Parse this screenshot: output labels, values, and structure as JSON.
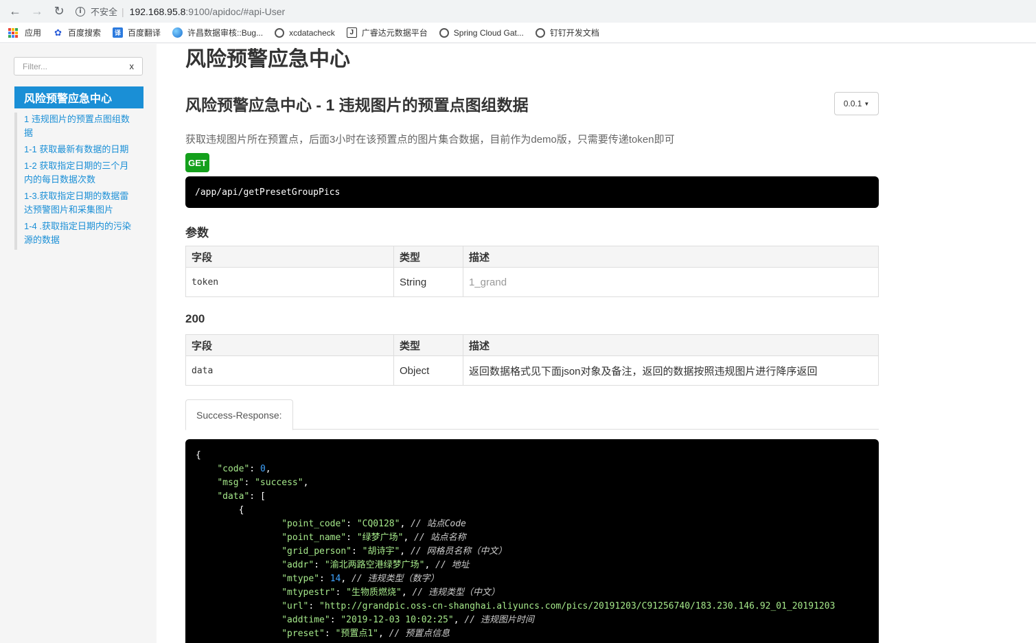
{
  "browser": {
    "insecure_label": "不安全",
    "url_host": "192.168.95.8",
    "url_path": ":9100/apidoc/#api-User",
    "bookmarks": [
      "应用",
      "百度搜索",
      "百度翻译",
      "许昌数据审核::Bug...",
      "xcdatacheck",
      "广睿达元数据平台",
      "Spring Cloud Gat...",
      "钉钉开发文档"
    ]
  },
  "sidebar": {
    "filter_placeholder": "Filter...",
    "filter_clear": "x",
    "header": "风险预警应急中心",
    "items": [
      "1 违规图片的预置点图组数据",
      "1-1 获取最新有数据的日期",
      "1-2 获取指定日期的三个月内的每日数据次数",
      "1-3.获取指定日期的数据雷达预警图片和采集图片",
      "1-4 .获取指定日期内的污染源的数据"
    ]
  },
  "main": {
    "group_title": "风险预警应急中心",
    "api_title": "风险预警应急中心 - 1 违规图片的预置点图组数据",
    "version": "0.0.1",
    "description": "获取违规图片所在预置点，后面3小时在该预置点的图片集合数据，目前作为demo版，只需要传递token即可",
    "method": "GET",
    "endpoint": "/app/api/getPresetGroupPics",
    "params_title": "参数",
    "params_headers": [
      "字段",
      "类型",
      "描述"
    ],
    "params_rows": [
      [
        "token",
        "String",
        "1_grand"
      ]
    ],
    "success_title": "200",
    "success_headers": [
      "字段",
      "类型",
      "描述"
    ],
    "success_rows": [
      [
        "data",
        "Object",
        "返回数据格式见下面json对象及备注，返回的数据按照违规图片进行降序返回"
      ]
    ],
    "response_tab": "Success-Response:",
    "code": {
      "l1": "{",
      "code_key": "\"code\"",
      "code_val": "0",
      "msg_key": "\"msg\"",
      "msg_val": "\"success\"",
      "data_key": "\"data\"",
      "data_open": "[",
      "obj_open": "{",
      "point_code_key": "\"point_code\"",
      "point_code_val": "\"CQ0128\"",
      "point_code_cmt": "// 站点Code",
      "point_name_key": "\"point_name\"",
      "point_name_val": "\"绿梦广场\"",
      "point_name_cmt": "// 站点名称",
      "grid_person_key": "\"grid_person\"",
      "grid_person_val": "\"胡诗宇\"",
      "grid_person_cmt": "// 网格员名称（中文）",
      "addr_key": "\"addr\"",
      "addr_val": "\"渝北两路空港绿梦广场\"",
      "addr_cmt": "// 地址",
      "mtype_key": "\"mtype\"",
      "mtype_val": "14",
      "mtype_cmt": "// 违规类型（数字）",
      "mtypestr_key": "\"mtypestr\"",
      "mtypestr_val": "\"生物质燃烧\"",
      "mtypestr_cmt": "// 违规类型（中文）",
      "url_key": "\"url\"",
      "url_val": "\"http://grandpic.oss-cn-shanghai.aliyuncs.com/pics/20191203/C91256740/183.230.146.92_01_20191203",
      "addtime_key": "\"addtime\"",
      "addtime_val": "\"2019-12-03 10:02:25\"",
      "addtime_cmt": "// 违规图片时间",
      "preset_key": "\"preset\"",
      "preset_val": "\"预置点1\"",
      "preset_cmt": "// 预置点信息"
    }
  }
}
